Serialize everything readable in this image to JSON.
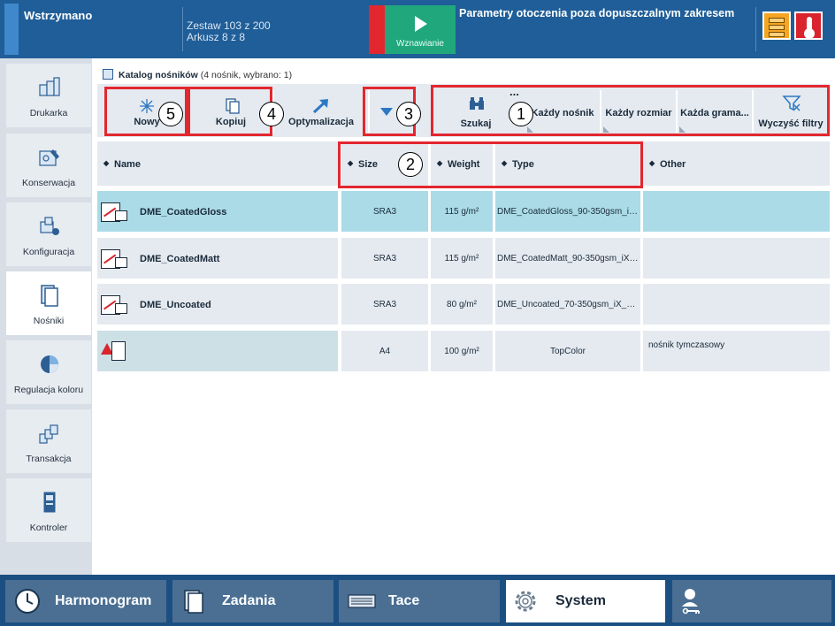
{
  "topbar": {
    "status": "Wstrzymano",
    "job_line1": "Zestaw 103 z 200",
    "job_line2": "Arkusz 8 z 8",
    "resume_label": "Wznawianie",
    "env_message": "Parametry otoczenia poza dopuszczalnym zakresem"
  },
  "sidebar": {
    "items": [
      {
        "label": "Drukarka",
        "icon": "printer-icon"
      },
      {
        "label": "Konserwacja",
        "icon": "maintenance-icon"
      },
      {
        "label": "Konfiguracja",
        "icon": "configuration-icon"
      },
      {
        "label": "Nośniki",
        "icon": "media-icon"
      },
      {
        "label": "Regulacja koloru",
        "icon": "color-icon"
      },
      {
        "label": "Transakcja",
        "icon": "transaction-icon"
      },
      {
        "label": "Kontroler",
        "icon": "controller-icon"
      }
    ],
    "active": "Nośniki"
  },
  "catalog": {
    "title": "Katalog nośników",
    "count_text": "(4 nośnik, wybrano: 1)"
  },
  "toolbar": {
    "new_label": "Nowy",
    "copy_label": "Kopiuj",
    "optimize_label": "Optymalizacja",
    "search_label": "Szukaj",
    "more_label": "...",
    "filter_media": "Każdy nośnik",
    "filter_size": "Każdy rozmiar",
    "filter_weight": "Każda grama...",
    "clear_filters": "Wyczyść filtry"
  },
  "callouts": [
    "1",
    "2",
    "3",
    "4",
    "5"
  ],
  "table": {
    "headers": {
      "name": "Name",
      "size": "Size",
      "weight": "Weight",
      "type": "Type",
      "other": "Other"
    },
    "rows": [
      {
        "name": "DME_CoatedGloss",
        "size": "SRA3",
        "weight": "115 g/m²",
        "type": "DME_CoatedGloss_90-350gsm_iX...",
        "other": "",
        "selected": true
      },
      {
        "name": "DME_CoatedMatt",
        "size": "SRA3",
        "weight": "115 g/m²",
        "type": "DME_CoatedMatt_90-350gsm_iX_...",
        "other": ""
      },
      {
        "name": "DME_Uncoated",
        "size": "SRA3",
        "weight": "80 g/m²",
        "type": "DME_Uncoated_70-350gsm_iX_R4...",
        "other": ""
      },
      {
        "name": "",
        "size": "A4",
        "weight": "100 g/m²",
        "type": "TopColor",
        "other": "nośnik tymczasowy"
      }
    ]
  },
  "bottom_nav": {
    "schedule": "Harmonogram",
    "jobs": "Zadania",
    "trays": "Tace",
    "system": "System"
  },
  "colors": {
    "topbar": "#1f5e98",
    "alert": "#e3272f",
    "resume": "#20a77c",
    "selected_row": "#aadbe7",
    "bottombar": "#1b4f82"
  }
}
